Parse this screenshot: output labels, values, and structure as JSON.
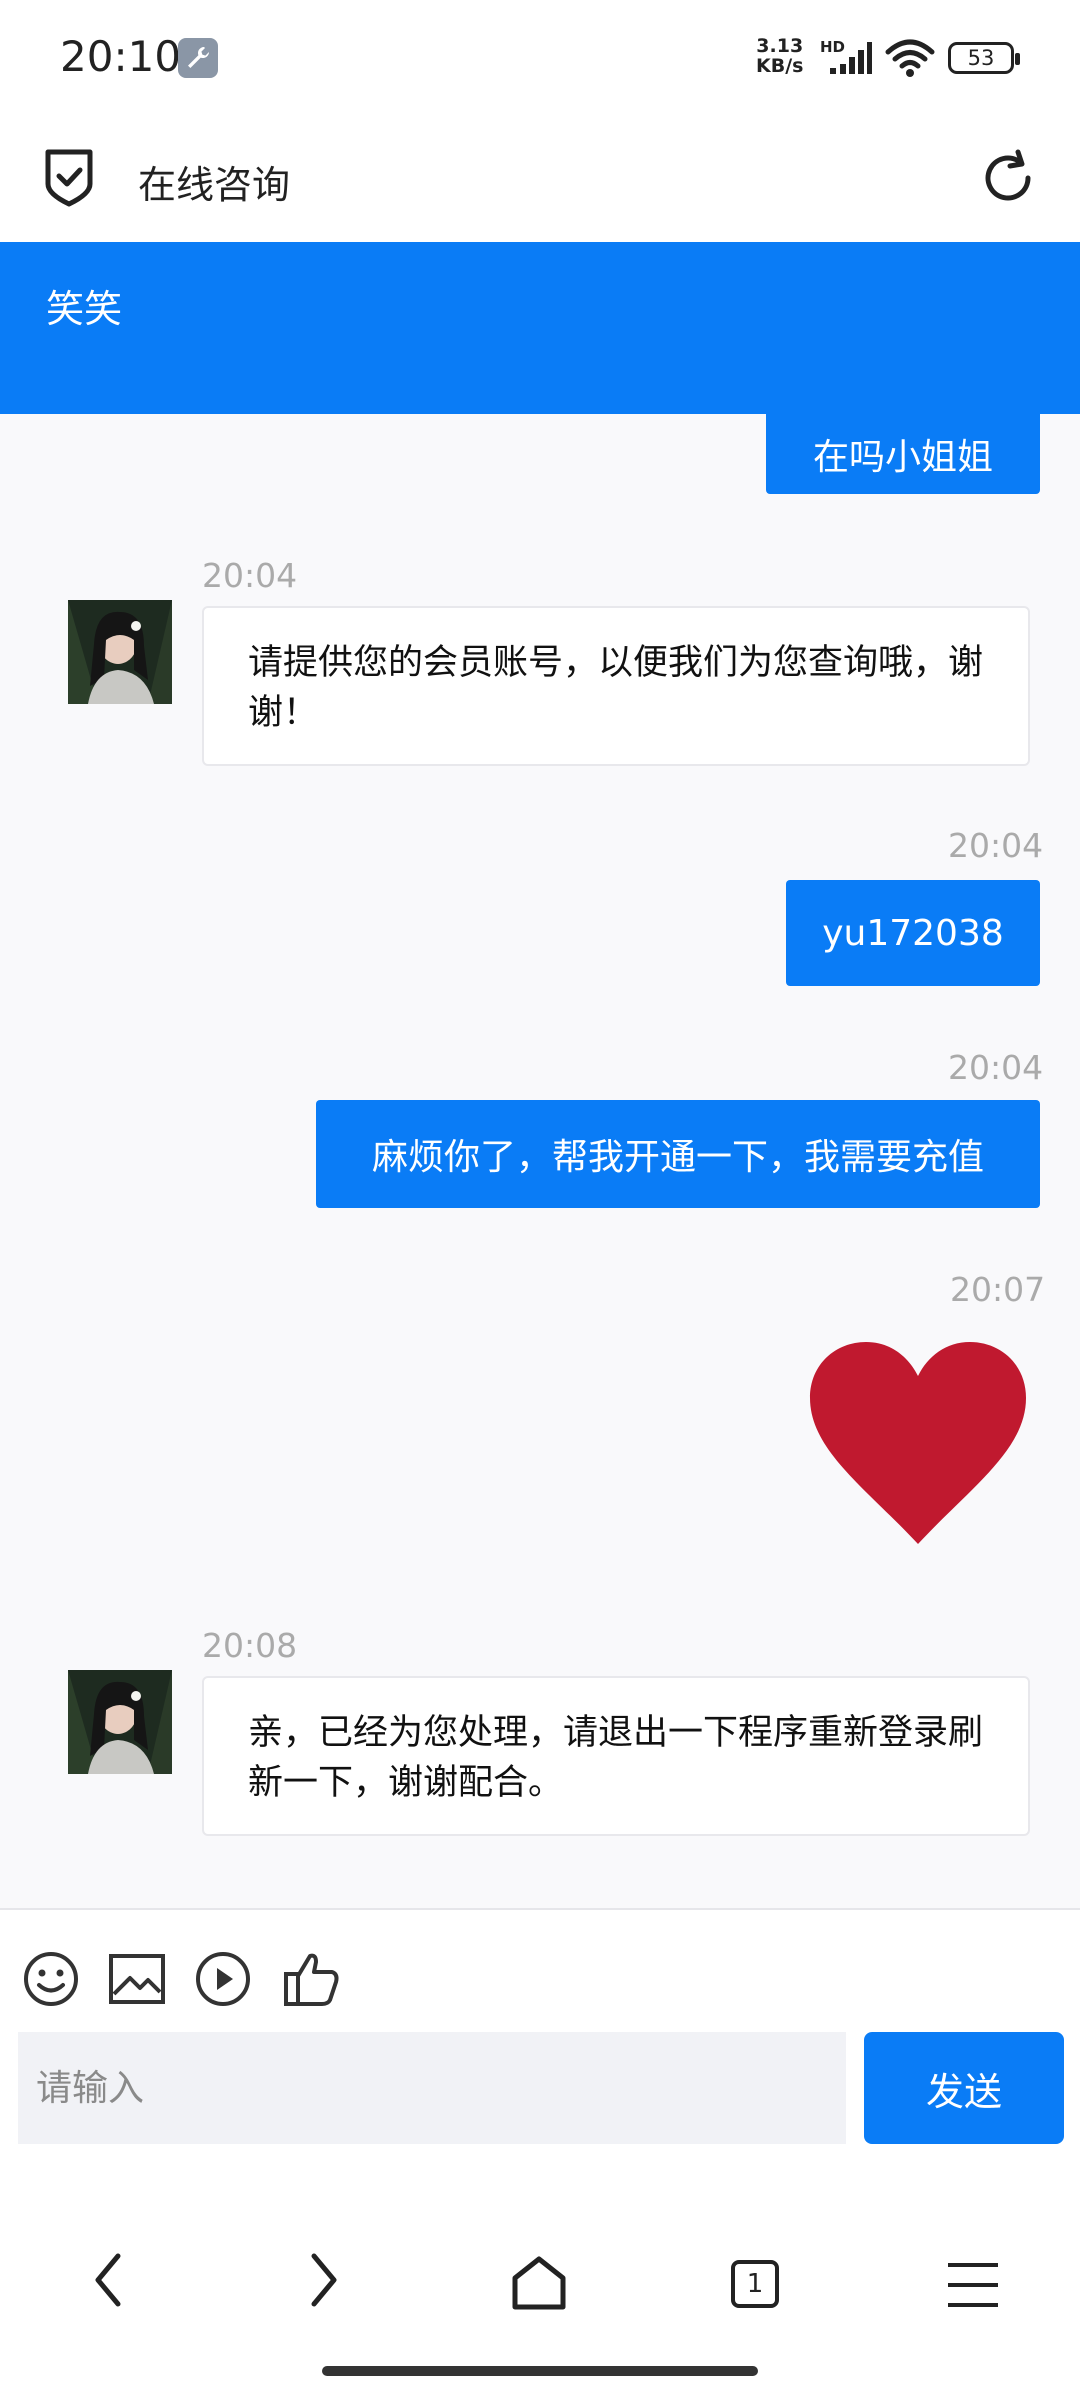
{
  "status_bar": {
    "time": "20:10",
    "net_speed_value": "3.13",
    "net_speed_unit": "KB/s",
    "hd": "HD",
    "battery": "53"
  },
  "browser": {
    "title": "在线咨询"
  },
  "chat": {
    "agent_name": "笑笑",
    "messages": [
      {
        "direction": "out",
        "text": "在吗小姐姐"
      },
      {
        "direction": "in",
        "time": "20:04",
        "text": "请提供您的会员账号，以便我们为您查询哦，谢谢！"
      },
      {
        "direction": "out",
        "time": "20:04",
        "text": "yu172038"
      },
      {
        "direction": "out",
        "time": "20:04",
        "text": "麻烦你了，帮我开通一下，我需要充值"
      },
      {
        "direction": "out",
        "time": "20:07",
        "sticker": "heart-icon"
      },
      {
        "direction": "in",
        "time": "20:08",
        "text": "亲，已经为您处理，请退出一下程序重新登录刷新一下，谢谢配合。"
      }
    ]
  },
  "toolbar": {
    "items": [
      "smiley-icon",
      "image-icon",
      "play-icon",
      "thumbs-up-icon"
    ]
  },
  "composer": {
    "placeholder": "请输入",
    "send_label": "发送"
  },
  "nav": {
    "tab_count": "1"
  },
  "colors": {
    "accent": "#0a7cf6",
    "heart": "#c0192f",
    "chat_bg": "#f9f9fb"
  }
}
